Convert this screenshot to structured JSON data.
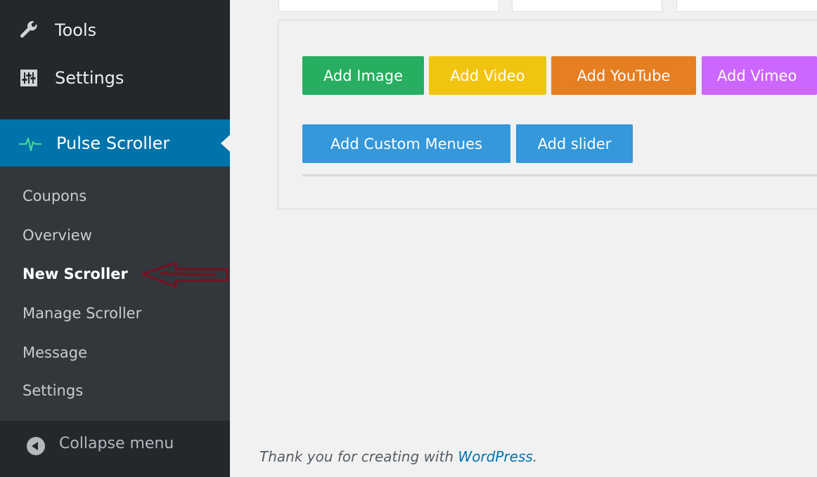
{
  "sidebar": {
    "tools_label": "Tools",
    "settings_label": "Settings",
    "plugin_label": "Pulse Scroller",
    "submenu": [
      {
        "label": "Coupons"
      },
      {
        "label": "Overview"
      },
      {
        "label": "New Scroller"
      },
      {
        "label": "Manage Scroller"
      },
      {
        "label": "Message"
      },
      {
        "label": "Settings"
      }
    ],
    "collapse_label": "Collapse menu"
  },
  "buttons": {
    "add_image": "Add Image",
    "add_video": "Add Video",
    "add_youtube": "Add YouTube",
    "add_vimeo": "Add Vimeo",
    "add_custom_menus": "Add Custom Menues",
    "add_slider": "Add slider"
  },
  "footer": {
    "text": "Thank you for creating with ",
    "link": "WordPress",
    "suffix": "."
  },
  "colors": {
    "sidebar_bg": "#23282d",
    "submenu_bg": "#32373c",
    "active_bg": "#0073aa",
    "pulse_icon": "#46d49a",
    "add_image_btn": "#27ae60",
    "add_video_btn": "#f1c40f",
    "add_youtube_btn": "#e67e22",
    "add_vimeo_btn": "#cc66ff",
    "add_blue_btn": "#3498db",
    "annotation_arrow": "#7a0f1f"
  },
  "icons": [
    "wrench-icon",
    "settings-sliders-icon",
    "pulse-icon",
    "collapse-arrow-icon"
  ]
}
